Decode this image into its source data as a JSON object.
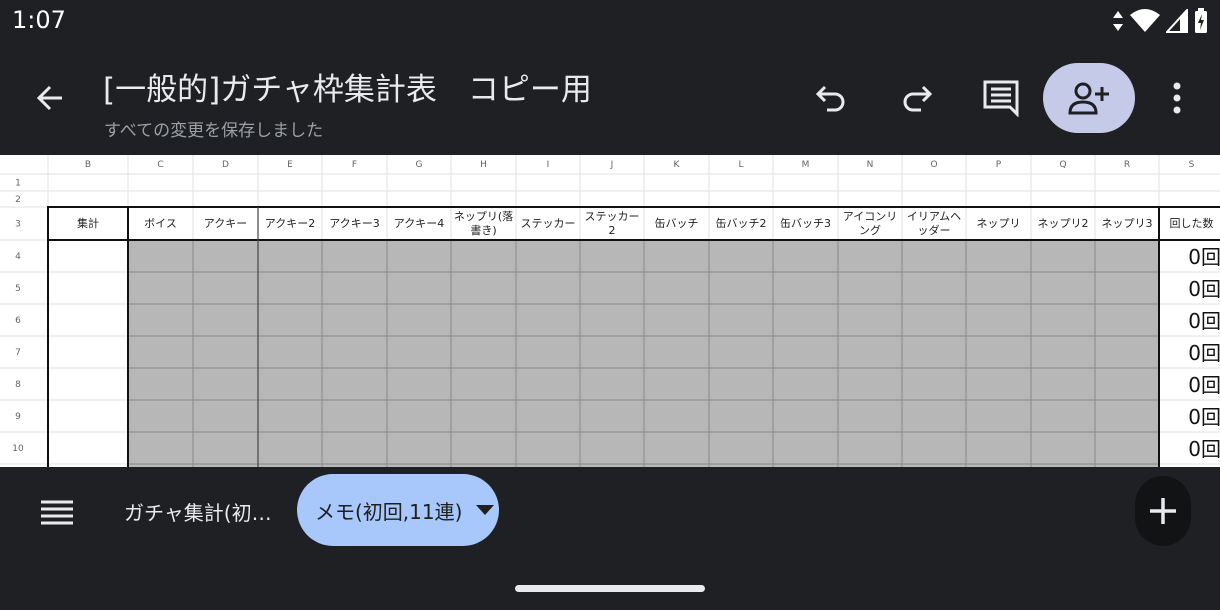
{
  "status_bar": {
    "time": "1:07"
  },
  "app_bar": {
    "title": "[一般的]ガチャ枠集計表　コピー用",
    "subtitle": "すべての変更を保存しました"
  },
  "icons": {
    "back": "arrow-back-icon",
    "undo": "undo-icon",
    "redo": "redo-icon",
    "comments": "comment-icon",
    "share": "person-add-icon",
    "more": "more-vert-icon",
    "sheets_menu": "list-icon",
    "dropdown": "arrow-drop-down-icon",
    "add_sheet": "plus-icon"
  },
  "colors": {
    "app_background": "#1f2023",
    "share_button": "#c5cae9",
    "active_tab": "#a8c7fa",
    "gray_cells": "#b7b7b7",
    "grid_lines": "#e2e2e2"
  },
  "spreadsheet": {
    "column_letters": [
      "B",
      "C",
      "D",
      "E",
      "F",
      "G",
      "H",
      "I",
      "J",
      "K",
      "L",
      "M",
      "N",
      "O",
      "P",
      "Q",
      "R",
      "S"
    ],
    "row_numbers": [
      "1",
      "2",
      "3",
      "4",
      "5",
      "6",
      "7",
      "8",
      "9",
      "10"
    ],
    "header_row": [
      "集計",
      "ボイス",
      "アクキー",
      "アクキー2",
      "アクキー3",
      "アクキー4",
      "ネップリ(落|書き)",
      "ステッカー",
      "ステッカー|2",
      "缶バッチ",
      "缶バッチ2",
      "缶バッチ3",
      "アイコンリ|ング",
      "イリアムヘ|ッダー",
      "ネップリ",
      "ネップリ2",
      "ネップリ3",
      "回した数"
    ],
    "count_values": [
      "0回",
      "0回",
      "0回",
      "0回",
      "0回",
      "0回",
      "0回"
    ]
  },
  "sheets": {
    "tab1": "ガチャ集計(初…",
    "active_tab": "メモ(初回,11連)"
  }
}
